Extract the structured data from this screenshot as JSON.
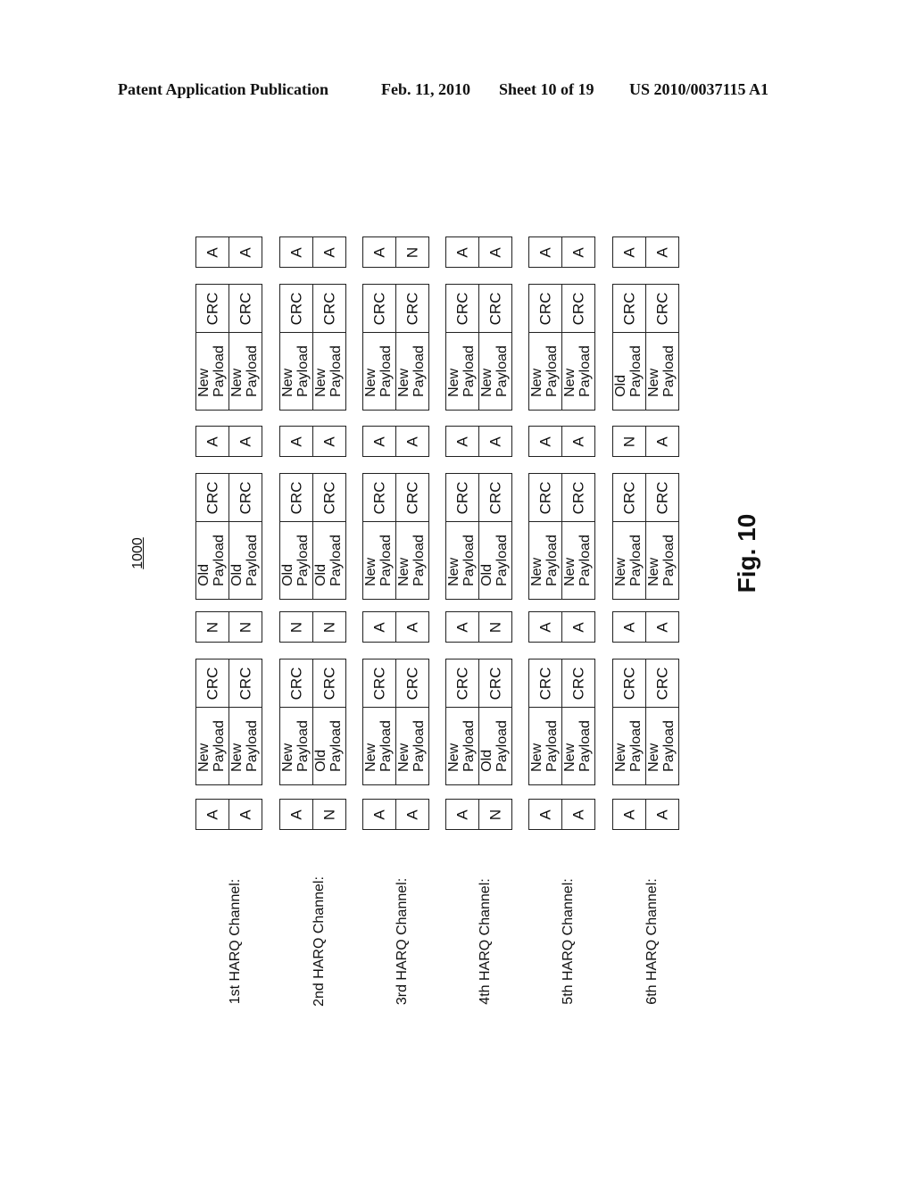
{
  "header": {
    "publication": "Patent Application Publication",
    "date": "Feb. 11, 2010",
    "sheet": "Sheet 10 of 19",
    "number": "US 2010/0037115 A1"
  },
  "figure": {
    "reference": "1000",
    "caption": "Fig. 10",
    "crc_label": "CRC",
    "channels": [
      {
        "label": "1st HARQ Channel:",
        "sequence": [
          {
            "type": "ack",
            "values": [
              "A",
              "A"
            ]
          },
          {
            "type": "packet",
            "payloads": [
              [
                "New",
                "Payload"
              ],
              [
                "New",
                "Payload"
              ]
            ]
          },
          {
            "type": "ack",
            "values": [
              "N",
              "N"
            ]
          },
          {
            "type": "packet",
            "payloads": [
              [
                "Old",
                "Payload"
              ],
              [
                "Old",
                "Payload"
              ]
            ]
          },
          {
            "type": "ack",
            "values": [
              "A",
              "A"
            ]
          },
          {
            "type": "packet",
            "payloads": [
              [
                "New",
                "Payload"
              ],
              [
                "New",
                "Payload"
              ]
            ]
          },
          {
            "type": "ack",
            "values": [
              "A",
              "A"
            ]
          }
        ]
      },
      {
        "label": "2nd HARQ Channel:",
        "sequence": [
          {
            "type": "ack",
            "values": [
              "A",
              "N"
            ]
          },
          {
            "type": "packet",
            "payloads": [
              [
                "New",
                "Payload"
              ],
              [
                "Old",
                "Payload"
              ]
            ]
          },
          {
            "type": "ack",
            "values": [
              "N",
              "N"
            ]
          },
          {
            "type": "packet",
            "payloads": [
              [
                "Old",
                "Payload"
              ],
              [
                "Old",
                "Payload"
              ]
            ]
          },
          {
            "type": "ack",
            "values": [
              "A",
              "A"
            ]
          },
          {
            "type": "packet",
            "payloads": [
              [
                "New",
                "Payload"
              ],
              [
                "New",
                "Payload"
              ]
            ]
          },
          {
            "type": "ack",
            "values": [
              "A",
              "A"
            ]
          }
        ]
      },
      {
        "label": "3rd HARQ Channel:",
        "sequence": [
          {
            "type": "ack",
            "values": [
              "A",
              "A"
            ]
          },
          {
            "type": "packet",
            "payloads": [
              [
                "New",
                "Payload"
              ],
              [
                "New",
                "Payload"
              ]
            ]
          },
          {
            "type": "ack",
            "values": [
              "A",
              "A"
            ]
          },
          {
            "type": "packet",
            "payloads": [
              [
                "New",
                "Payload"
              ],
              [
                "New",
                "Payload"
              ]
            ]
          },
          {
            "type": "ack",
            "values": [
              "A",
              "A"
            ]
          },
          {
            "type": "packet",
            "payloads": [
              [
                "New",
                "Payload"
              ],
              [
                "New",
                "Payload"
              ]
            ]
          },
          {
            "type": "ack",
            "values": [
              "A",
              "N"
            ]
          }
        ]
      },
      {
        "label": "4th HARQ Channel:",
        "sequence": [
          {
            "type": "ack",
            "values": [
              "A",
              "N"
            ]
          },
          {
            "type": "packet",
            "payloads": [
              [
                "New",
                "Payload"
              ],
              [
                "Old",
                "Payload"
              ]
            ]
          },
          {
            "type": "ack",
            "values": [
              "A",
              "N"
            ]
          },
          {
            "type": "packet",
            "payloads": [
              [
                "New",
                "Payload"
              ],
              [
                "Old",
                "Payload"
              ]
            ]
          },
          {
            "type": "ack",
            "values": [
              "A",
              "A"
            ]
          },
          {
            "type": "packet",
            "payloads": [
              [
                "New",
                "Payload"
              ],
              [
                "New",
                "Payload"
              ]
            ]
          },
          {
            "type": "ack",
            "values": [
              "A",
              "A"
            ]
          }
        ]
      },
      {
        "label": "5th HARQ Channel:",
        "sequence": [
          {
            "type": "ack",
            "values": [
              "A",
              "A"
            ]
          },
          {
            "type": "packet",
            "payloads": [
              [
                "New",
                "Payload"
              ],
              [
                "New",
                "Payload"
              ]
            ]
          },
          {
            "type": "ack",
            "values": [
              "A",
              "A"
            ]
          },
          {
            "type": "packet",
            "payloads": [
              [
                "New",
                "Payload"
              ],
              [
                "New",
                "Payload"
              ]
            ]
          },
          {
            "type": "ack",
            "values": [
              "A",
              "A"
            ]
          },
          {
            "type": "packet",
            "payloads": [
              [
                "New",
                "Payload"
              ],
              [
                "New",
                "Payload"
              ]
            ]
          },
          {
            "type": "ack",
            "values": [
              "A",
              "A"
            ]
          }
        ]
      },
      {
        "label": "6th HARQ Channel:",
        "sequence": [
          {
            "type": "ack",
            "values": [
              "A",
              "A"
            ]
          },
          {
            "type": "packet",
            "payloads": [
              [
                "New",
                "Payload"
              ],
              [
                "New",
                "Payload"
              ]
            ]
          },
          {
            "type": "ack",
            "values": [
              "A",
              "A"
            ]
          },
          {
            "type": "packet",
            "payloads": [
              [
                "New",
                "Payload"
              ],
              [
                "New",
                "Payload"
              ]
            ]
          },
          {
            "type": "ack",
            "values": [
              "N",
              "A"
            ]
          },
          {
            "type": "packet",
            "payloads": [
              [
                "Old",
                "Payload"
              ],
              [
                "New",
                "Payload"
              ]
            ]
          },
          {
            "type": "ack",
            "values": [
              "A",
              "A"
            ]
          }
        ]
      }
    ]
  }
}
